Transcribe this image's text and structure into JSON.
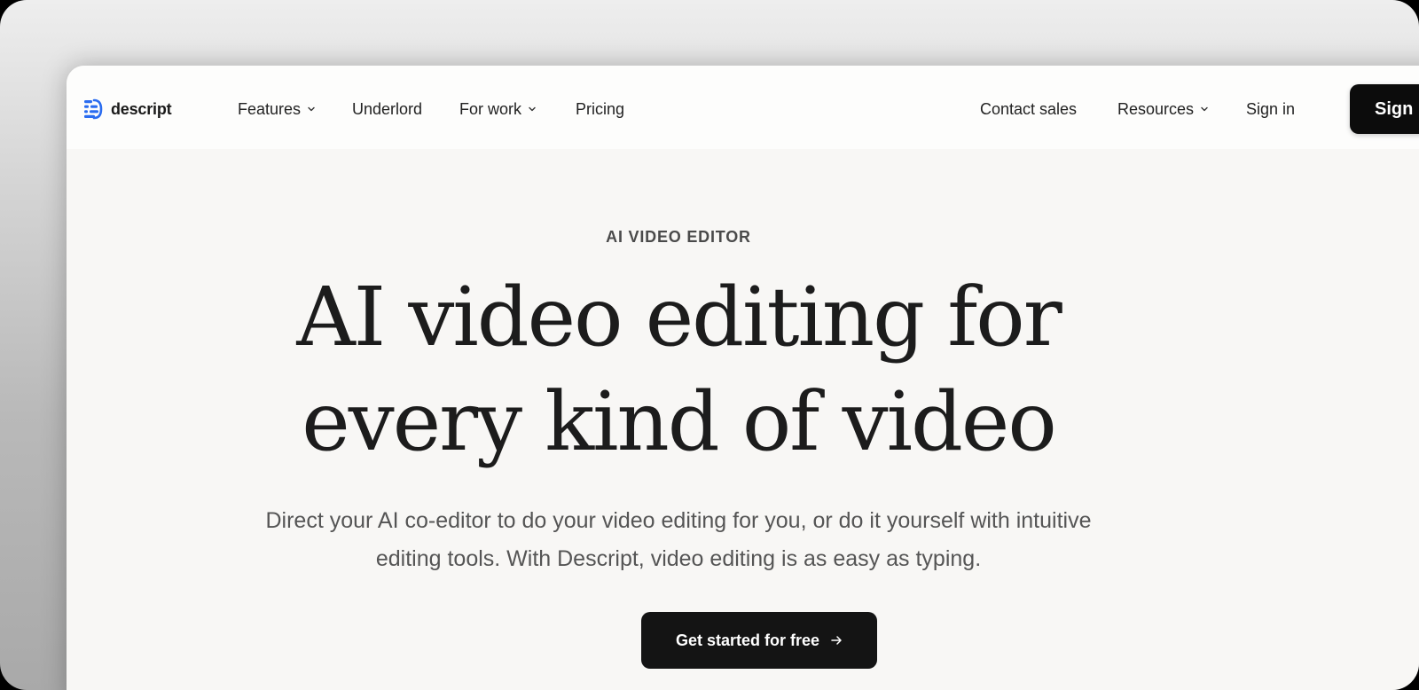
{
  "brand": {
    "name": "descript",
    "logo_color": "#2a6cf0"
  },
  "nav": {
    "left": [
      {
        "label": "Features",
        "has_dropdown": true
      },
      {
        "label": "Underlord",
        "has_dropdown": false
      },
      {
        "label": "For work",
        "has_dropdown": true
      },
      {
        "label": "Pricing",
        "has_dropdown": false
      }
    ],
    "right": [
      {
        "label": "Contact sales",
        "has_dropdown": false
      },
      {
        "label": "Resources",
        "has_dropdown": true
      },
      {
        "label": "Sign in",
        "has_dropdown": false
      }
    ],
    "signup_label": "Sign"
  },
  "hero": {
    "eyebrow": "AI VIDEO EDITOR",
    "headline_line1": "AI video editing for",
    "headline_line2": "every kind of video",
    "sub_line1": "Direct your AI co-editor to do your video editing for you, or do it yourself with intuitive",
    "sub_line2": "editing tools. With Descript, video editing is as easy as typing.",
    "cta_label": "Get started for free",
    "cta_icon": "arrow-right-icon"
  }
}
